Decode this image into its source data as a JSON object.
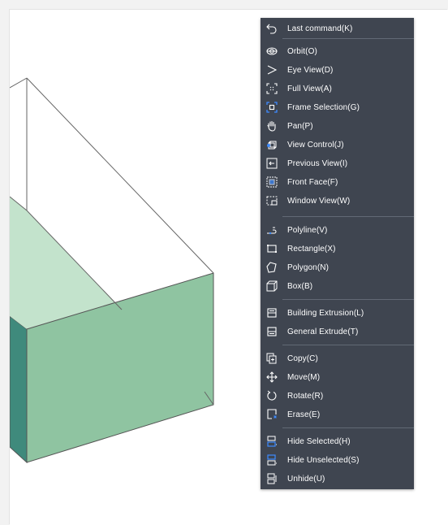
{
  "menu": {
    "items": [
      {
        "label": "Last command(K)",
        "icon": "undo-arrow-icon"
      },
      {
        "label": "Orbit(O)",
        "icon": "orbit-icon"
      },
      {
        "label": "Eye View(D)",
        "icon": "eye-view-icon"
      },
      {
        "label": "Full View(A)",
        "icon": "full-view-icon"
      },
      {
        "label": "Frame Selection(G)",
        "icon": "frame-selection-icon"
      },
      {
        "label": "Pan(P)",
        "icon": "pan-hand-icon"
      },
      {
        "label": "View Control(J)",
        "icon": "view-control-icon"
      },
      {
        "label": "Previous View(I)",
        "icon": "previous-view-icon"
      },
      {
        "label": "Front Face(F)",
        "icon": "front-face-icon"
      },
      {
        "label": "Window View(W)",
        "icon": "window-view-icon"
      },
      {
        "label": "Polyline(V)",
        "icon": "polyline-icon"
      },
      {
        "label": "Rectangle(X)",
        "icon": "rectangle-icon"
      },
      {
        "label": "Polygon(N)",
        "icon": "polygon-icon"
      },
      {
        "label": "Box(B)",
        "icon": "box-icon"
      },
      {
        "label": "Building Extrusion(L)",
        "icon": "building-extrusion-icon"
      },
      {
        "label": "General Extrude(T)",
        "icon": "general-extrude-icon"
      },
      {
        "label": "Copy(C)",
        "icon": "copy-icon"
      },
      {
        "label": "Move(M)",
        "icon": "move-icon"
      },
      {
        "label": "Rotate(R)",
        "icon": "rotate-icon"
      },
      {
        "label": "Erase(E)",
        "icon": "erase-icon"
      },
      {
        "label": "Hide Selected(H)",
        "icon": "hide-selected-icon"
      },
      {
        "label": "Hide Unselected(S)",
        "icon": "hide-unselected-icon"
      },
      {
        "label": "Unhide(U)",
        "icon": "unhide-icon"
      }
    ]
  },
  "colors": {
    "menu_background": "#3f4550",
    "menu_text": "#ffffff",
    "accent_blue": "#3d8bff",
    "face_front": "#8fc4a1",
    "face_top": "#c3e3cc",
    "face_side": "#3f8a7c"
  }
}
